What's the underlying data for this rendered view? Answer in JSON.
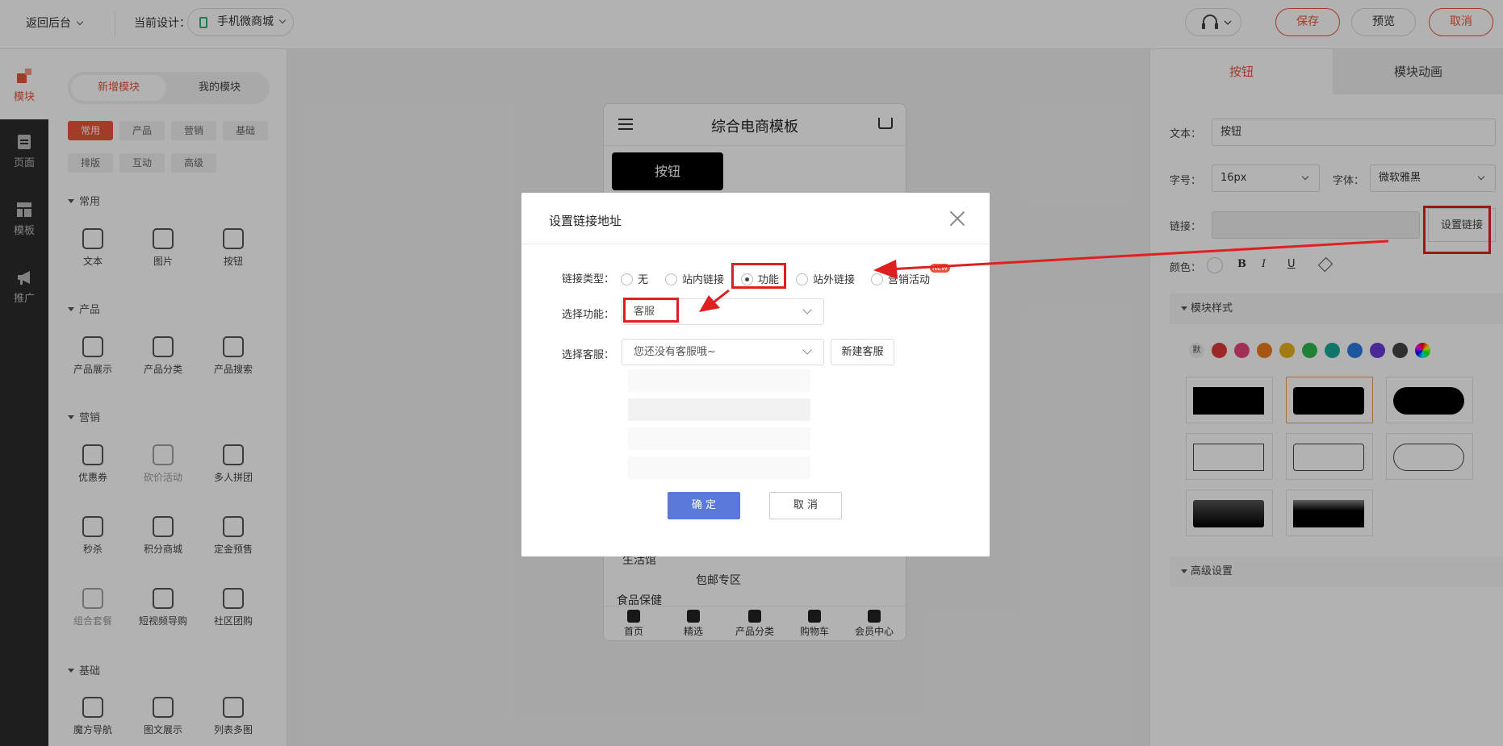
{
  "topbar": {
    "back_label": "返回后台",
    "current_design_label": "当前设计：",
    "design_name": "手机微商城",
    "save_label": "保存",
    "preview_label": "预览",
    "cancel_label": "取消"
  },
  "leftnav": {
    "items": [
      {
        "label": "模块",
        "icon": "blocks-icon"
      },
      {
        "label": "页面",
        "icon": "page-icon"
      },
      {
        "label": "模板",
        "icon": "template-icon"
      },
      {
        "label": "推广",
        "icon": "megaphone-icon"
      }
    ]
  },
  "leftpanel": {
    "tabs": [
      "新增模块",
      "我的模块"
    ],
    "chips": [
      "常用",
      "产品",
      "营销",
      "基础",
      "排版",
      "互动",
      "高级"
    ],
    "sections": [
      {
        "title": "常用",
        "items": [
          "文本",
          "图片",
          "按钮"
        ]
      },
      {
        "title": "产品",
        "items": [
          "产品展示",
          "产品分类",
          "产品搜索"
        ]
      },
      {
        "title": "营销",
        "items": [
          "优惠券",
          "砍价活动",
          "多人拼团",
          "秒杀",
          "积分商城",
          "定金预售",
          "组合套餐",
          "短视频导购",
          "社区团购"
        ]
      },
      {
        "title": "基础",
        "items": [
          "魔方导航",
          "图文展示",
          "列表多图"
        ]
      }
    ]
  },
  "phone": {
    "title": "综合电商模板",
    "button_label": "按钮",
    "list_a": "生活馆",
    "list_b": "包邮专区",
    "list_c": "食品保健",
    "tabs": [
      "首页",
      "精选",
      "产品分类",
      "购物车",
      "会员中心"
    ]
  },
  "rightpanel": {
    "tabs": [
      "按钮",
      "模块动画"
    ],
    "text_label": "文本：",
    "text_value": "按钮",
    "size_label": "字号：",
    "size_value": "16px",
    "font_label": "字体：",
    "font_value": "微软雅黑",
    "link_label": "链接：",
    "set_link_label": "设置链接",
    "color_label": "颜色：",
    "format_b": "B",
    "format_i": "I",
    "format_u": "U",
    "module_style_label": "模块样式",
    "default_swatch": "默",
    "swatches": [
      "#e03a3a",
      "#e8457a",
      "#f07a1a",
      "#e8b21a",
      "#2eb84d",
      "#1aa89a",
      "#2a7ae2",
      "#6a3ad8",
      "#444444"
    ],
    "advanced_label": "高级设置"
  },
  "dialog": {
    "title": "设置链接地址",
    "link_type_label": "链接类型：",
    "options": [
      "无",
      "站内链接",
      "功能",
      "站外链接",
      "营销活动"
    ],
    "selected_option": "功能",
    "new_badge": "NEW",
    "function_label": "选择功能：",
    "function_value": "客服",
    "service_label": "选择客服：",
    "service_placeholder": "您还没有客服哦~",
    "new_service_label": "新建客服",
    "ok_label": "确 定",
    "cancel_label": "取 消"
  },
  "colors": {
    "accent": "#e8553a",
    "highlight": "#e02020",
    "primary_button": "#5a79db"
  }
}
